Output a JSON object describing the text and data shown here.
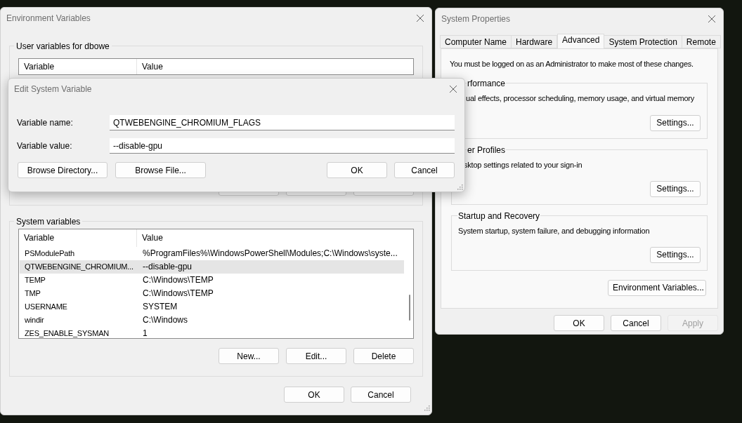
{
  "env_window": {
    "title": "Environment Variables",
    "user_group": {
      "label": "User variables for dbowe",
      "columns": [
        "Variable",
        "Value"
      ]
    },
    "system_group": {
      "label": "System variables",
      "columns": [
        "Variable",
        "Value"
      ],
      "rows": [
        {
          "variable": "PSModulePath",
          "value": "%ProgramFiles%\\WindowsPowerShell\\Modules;C:\\Windows\\syste...",
          "selected": false
        },
        {
          "variable": "QTWEBENGINE_CHROMIUM...",
          "value": "--disable-gpu",
          "selected": true
        },
        {
          "variable": "TEMP",
          "value": "C:\\Windows\\TEMP",
          "selected": false
        },
        {
          "variable": "TMP",
          "value": "C:\\Windows\\TEMP",
          "selected": false
        },
        {
          "variable": "USERNAME",
          "value": "SYSTEM",
          "selected": false
        },
        {
          "variable": "windir",
          "value": "C:\\Windows",
          "selected": false
        },
        {
          "variable": "ZES_ENABLE_SYSMAN",
          "value": "1",
          "selected": false
        }
      ],
      "buttons": [
        "New...",
        "Edit...",
        "Delete"
      ]
    },
    "buttons": [
      "OK",
      "Cancel"
    ]
  },
  "system_properties": {
    "title": "System Properties",
    "tabs": [
      {
        "label": "Computer Name",
        "selected": false
      },
      {
        "label": "Hardware",
        "selected": false
      },
      {
        "label": "Advanced",
        "selected": true
      },
      {
        "label": "System Protection",
        "selected": false
      },
      {
        "label": "Remote",
        "selected": false
      }
    ],
    "notice": "You must be logged on as an Administrator to make most of these changes.",
    "groups": [
      {
        "label": "rformance",
        "description": "ual effects, processor scheduling, memory usage, and virtual memory",
        "button": "Settings..."
      },
      {
        "label": "er Profiles",
        "description": "sktop settings related to your sign-in",
        "button": "Settings..."
      },
      {
        "label": "Startup and Recovery",
        "description": "System startup, system failure, and debugging information",
        "button": "Settings..."
      }
    ],
    "env_button": "Environment Variables...",
    "buttons": [
      {
        "label": "OK",
        "disabled": false
      },
      {
        "label": "Cancel",
        "disabled": false
      },
      {
        "label": "Apply",
        "disabled": true
      }
    ]
  },
  "edit_dialog": {
    "title": "Edit System Variable",
    "fields": [
      {
        "label": "Variable name:",
        "value": "QTWEBENGINE_CHROMIUM_FLAGS"
      },
      {
        "label": "Variable value:",
        "value": "--disable-gpu"
      }
    ],
    "left_buttons": [
      "Browse Directory...",
      "Browse File..."
    ],
    "right_buttons": [
      "OK",
      "Cancel"
    ]
  }
}
